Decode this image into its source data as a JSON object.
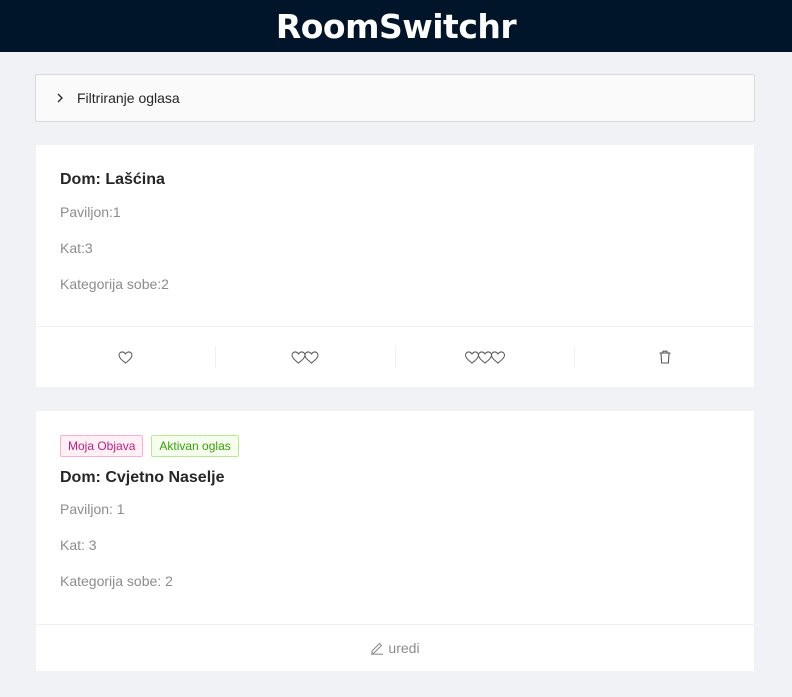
{
  "header": {
    "title": "RoomSwitchr"
  },
  "filter": {
    "label": "Filtriranje oglasa",
    "icon": "chevron-right-icon"
  },
  "cards": [
    {
      "title": "Dom: Lašćina",
      "lines": [
        "Paviljon:1",
        "Kat:3",
        "Kategorija sobe:2"
      ],
      "actions": [
        {
          "icon": "heart-icon",
          "count": 1
        },
        {
          "icon": "two-hearts-icon",
          "count": 2
        },
        {
          "icon": "three-hearts-icon",
          "count": 3
        },
        {
          "icon": "delete-icon"
        }
      ]
    },
    {
      "tags": [
        {
          "label": "Moja Objava",
          "color": "#c41d7f"
        },
        {
          "label": "Aktivan oglas",
          "color": "#389e0d"
        }
      ],
      "title": "Dom: Cvjetno Naselje",
      "lines": [
        "Paviljon: 1",
        "Kat: 3",
        "Kategorija sobe: 2"
      ],
      "edit_label": "uredi",
      "edit_icon": "edit-icon"
    }
  ]
}
